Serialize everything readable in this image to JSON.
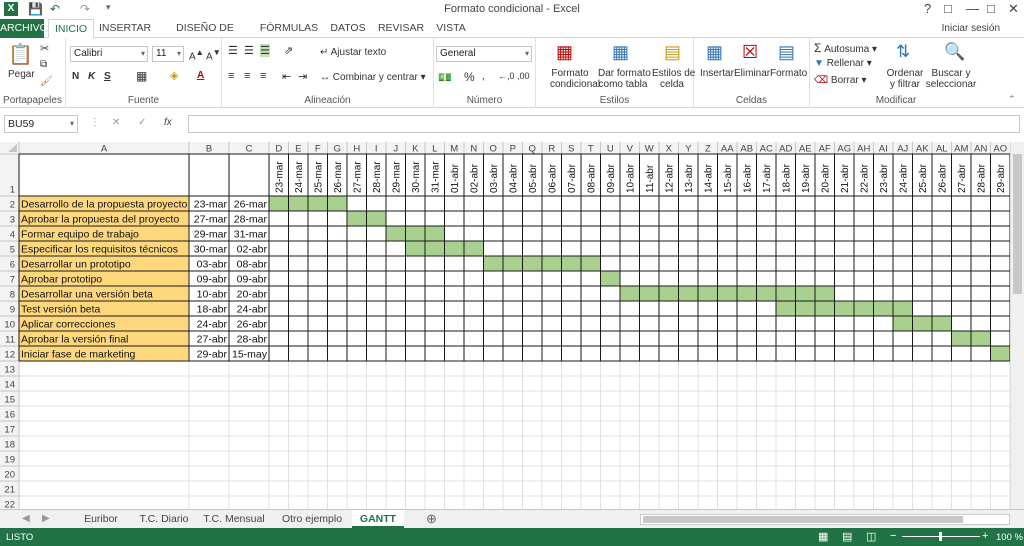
{
  "window": {
    "title": "Formato condicional - Excel",
    "help": "?",
    "signin": "Iniciar sesión"
  },
  "tabs": [
    "ARCHIVO",
    "INICIO",
    "INSERTAR",
    "DISEÑO DE PÁGINA",
    "FÓRMULAS",
    "DATOS",
    "REVISAR",
    "VISTA"
  ],
  "ribbon": {
    "clipboard": {
      "paste": "Pegar",
      "label": "Portapapeles"
    },
    "font": {
      "name": "Calibri",
      "size": "11",
      "bold": "N",
      "italic": "K",
      "underline": "S",
      "label": "Fuente"
    },
    "alignment": {
      "wrap": "Ajustar texto",
      "merge": "Combinar y centrar",
      "label": "Alineación"
    },
    "number": {
      "format": "General",
      "label": "Número"
    },
    "styles": {
      "cond_format_1": "Formato",
      "cond_format_2": "condicional",
      "table_1": "Dar formato",
      "table_2": "como tabla",
      "cell_1": "Estilos de",
      "cell_2": "celda",
      "label": "Estilos"
    },
    "cells": {
      "insert": "Insertar",
      "delete": "Eliminar",
      "format": "Formato",
      "label": "Celdas"
    },
    "editing": {
      "autosum": "Autosuma",
      "fill": "Rellenar",
      "clear": "Borrar",
      "sort_1": "Ordenar",
      "sort_2": "y filtrar",
      "find_1": "Buscar y",
      "find_2": "seleccionar",
      "label": "Modificar"
    }
  },
  "formula_bar": {
    "name_box": "BU59",
    "fx": "fx",
    "value": ""
  },
  "grid": {
    "col_headers": [
      "A",
      "B",
      "C",
      "D",
      "E",
      "F",
      "G",
      "H",
      "I",
      "J",
      "K",
      "L",
      "M",
      "N",
      "O",
      "P",
      "Q",
      "R",
      "S",
      "T",
      "U",
      "V",
      "W",
      "X",
      "Y",
      "Z",
      "AA",
      "AB",
      "AC",
      "AD",
      "AE",
      "AF",
      "AG",
      "AH",
      "AI",
      "AJ",
      "AK",
      "AL",
      "AM",
      "AN",
      "AO"
    ],
    "row_count": 22,
    "dates": [
      "23-mar",
      "24-mar",
      "25-mar",
      "26-mar",
      "27-mar",
      "28-mar",
      "29-mar",
      "30-mar",
      "31-mar",
      "01-abr",
      "02-abr",
      "03-abr",
      "04-abr",
      "05-abr",
      "06-abr",
      "07-abr",
      "08-abr",
      "09-abr",
      "10-abr",
      "11-abr",
      "12-abr",
      "13-abr",
      "14-abr",
      "15-abr",
      "16-abr",
      "17-abr",
      "18-abr",
      "19-abr",
      "20-abr",
      "21-abr",
      "22-abr",
      "23-abr",
      "24-abr",
      "25-abr",
      "26-abr",
      "27-abr",
      "28-abr",
      "29-abr"
    ],
    "tasks": [
      {
        "name": "Desarrollo de la propuesta proyecto",
        "start": "23-mar",
        "end": "26-mar",
        "s": 0,
        "e": 3
      },
      {
        "name": "Aprobar la propuesta del proyecto",
        "start": "27-mar",
        "end": "28-mar",
        "s": 4,
        "e": 5
      },
      {
        "name": "Formar equipo de trabajo",
        "start": "29-mar",
        "end": "31-mar",
        "s": 6,
        "e": 8
      },
      {
        "name": "Especificar los requisitos técnicos",
        "start": "30-mar",
        "end": "02-abr",
        "s": 7,
        "e": 10
      },
      {
        "name": "Desarrollar un prototipo",
        "start": "03-abr",
        "end": "08-abr",
        "s": 11,
        "e": 16
      },
      {
        "name": "Aprobar prototipo",
        "start": "09-abr",
        "end": "09-abr",
        "s": 17,
        "e": 17
      },
      {
        "name": "Desarrollar una versión beta",
        "start": "10-abr",
        "end": "20-abr",
        "s": 18,
        "e": 28
      },
      {
        "name": "Test versión beta",
        "start": "18-abr",
        "end": "24-abr",
        "s": 26,
        "e": 32
      },
      {
        "name": "Aplicar correcciones",
        "start": "24-abr",
        "end": "26-abr",
        "s": 32,
        "e": 34
      },
      {
        "name": "Aprobar la versión final",
        "start": "27-abr",
        "end": "28-abr",
        "s": 35,
        "e": 36
      },
      {
        "name": "Iniciar fase de marketing",
        "start": "29-abr",
        "end": "15-may",
        "s": 37,
        "e": 37
      }
    ]
  },
  "sheets": [
    "Euribor",
    "T.C. Diario",
    "T.C. Mensual",
    "Otro ejemplo",
    "GANTT"
  ],
  "active_sheet": "GANTT",
  "status": {
    "mode": "LISTO",
    "zoom": "100 %"
  },
  "colors": {
    "green": "#217346",
    "task_fill": "#ffd87e",
    "gantt_fill": "#a9d08e"
  }
}
